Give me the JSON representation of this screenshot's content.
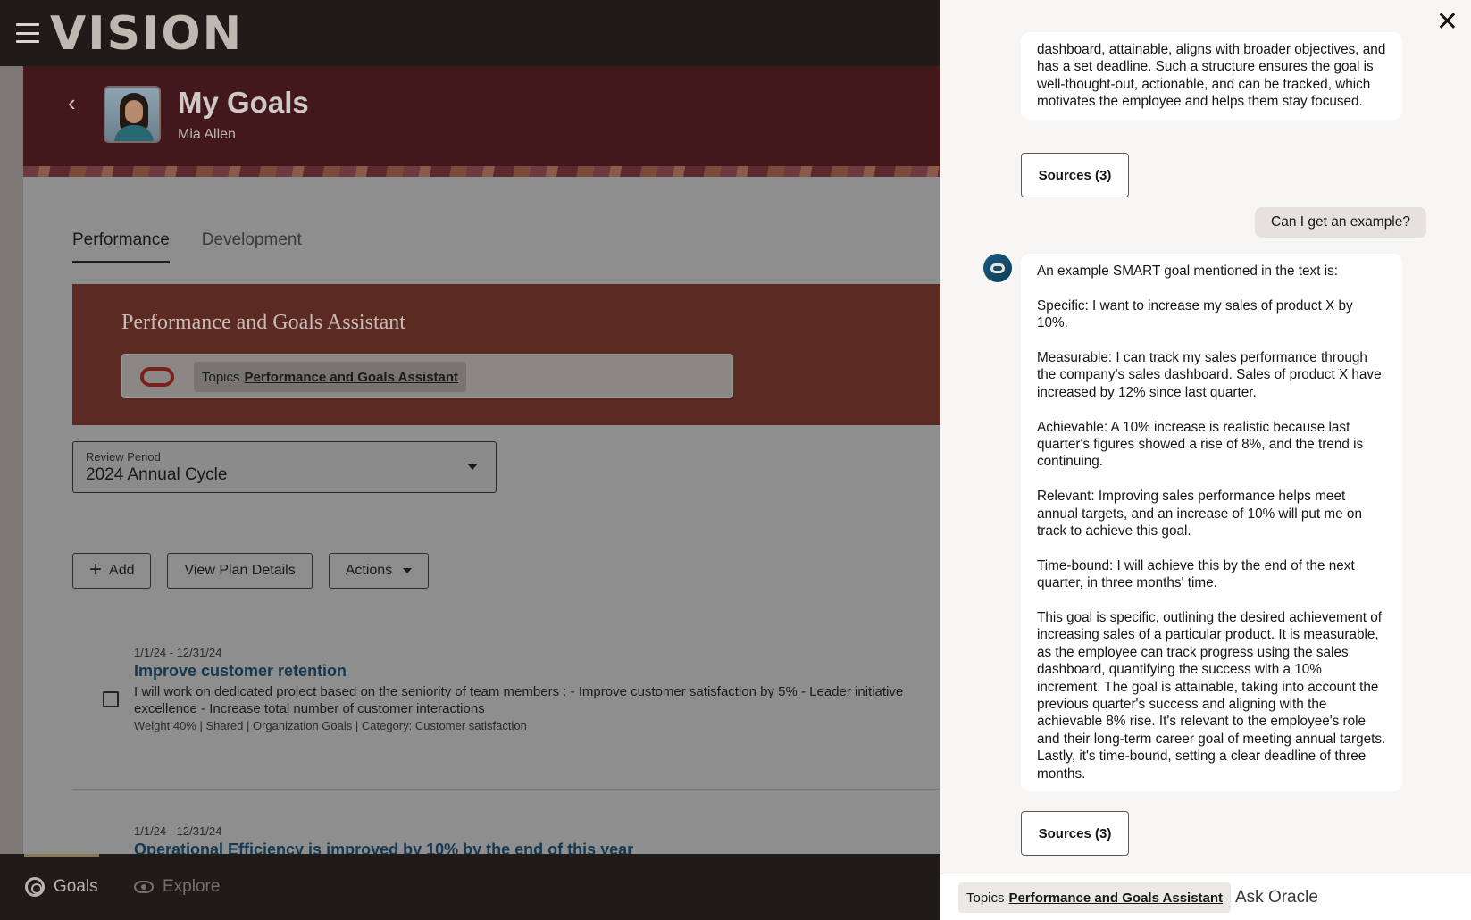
{
  "app": {
    "logo": "VISION"
  },
  "banner": {
    "title": "My Goals",
    "user_name": "Mia Allen"
  },
  "tabs": [
    {
      "label": "Performance",
      "active": true
    },
    {
      "label": "Development",
      "active": false
    }
  ],
  "assistant": {
    "title": "Performance and Goals Assistant",
    "topics_prefix": "Topics",
    "topics_link": "Performance and Goals Assistant"
  },
  "review_period": {
    "label": "Review Period",
    "value": "2024 Annual Cycle"
  },
  "toolbar": {
    "add_label": "Add",
    "view_plan_label": "View Plan Details",
    "actions_label": "Actions"
  },
  "goals": [
    {
      "date_range": "1/1/24 - 12/31/24",
      "title": "Improve customer retention",
      "description": "I will work on dedicated project based on the seniority of team members : - Improve customer satisfaction by 5% - Leader initiative excellence - Increase total number of customer interactions",
      "meta": "Weight 40% | Shared | Organization Goals | Category: Customer satisfaction"
    },
    {
      "date_range": "1/1/24 - 12/31/24",
      "title": "Operational Efficiency is improved by 10% by the end of this year"
    }
  ],
  "bottom_nav": {
    "goals_label": "Goals",
    "explore_label": "Explore"
  },
  "chat": {
    "messages": {
      "prev_answer_tail": "dashboard, attainable, aligns with broader objectives, and has a set deadline. Such a structure ensures the goal is well-thought-out, actionable, and can be tracked, which motivates the employee and helps them stay focused.",
      "user_question": "Can I get an example?",
      "answer_paragraphs": [
        "An example SMART goal mentioned in the text is:",
        "Specific: I want to increase my sales of product X by 10%.",
        "Measurable: I can track my sales performance through the company's sales dashboard. Sales of product X have increased by 12% since last quarter.",
        "Achievable: A 10% increase is realistic because last quarter's figures showed a rise of 8%, and the trend is continuing.",
        "Relevant: Improving sales performance helps meet annual targets, and an increase of 10% will put me on track to achieve this goal.",
        "Time-bound: I will achieve this by the end of the next quarter, in three months' time.",
        "This goal is specific, outlining the desired achievement of increasing sales of a particular product. It is measurable, as the employee can track progress using the sales dashboard, quantifying the success with a 10% increment. The goal is attainable, taking into account the previous quarter's success and aligning with the achievable 8% rise. It's relevant to the employee's role and their long-term career goal of meeting annual targets. Lastly, it's time-bound, setting a clear deadline of three months."
      ]
    },
    "sources_label": "Sources (3)",
    "footer": {
      "topics_prefix": "Topics",
      "topics_link": "Performance and Goals Assistant",
      "ask_placeholder": "Ask Oracle"
    }
  }
}
